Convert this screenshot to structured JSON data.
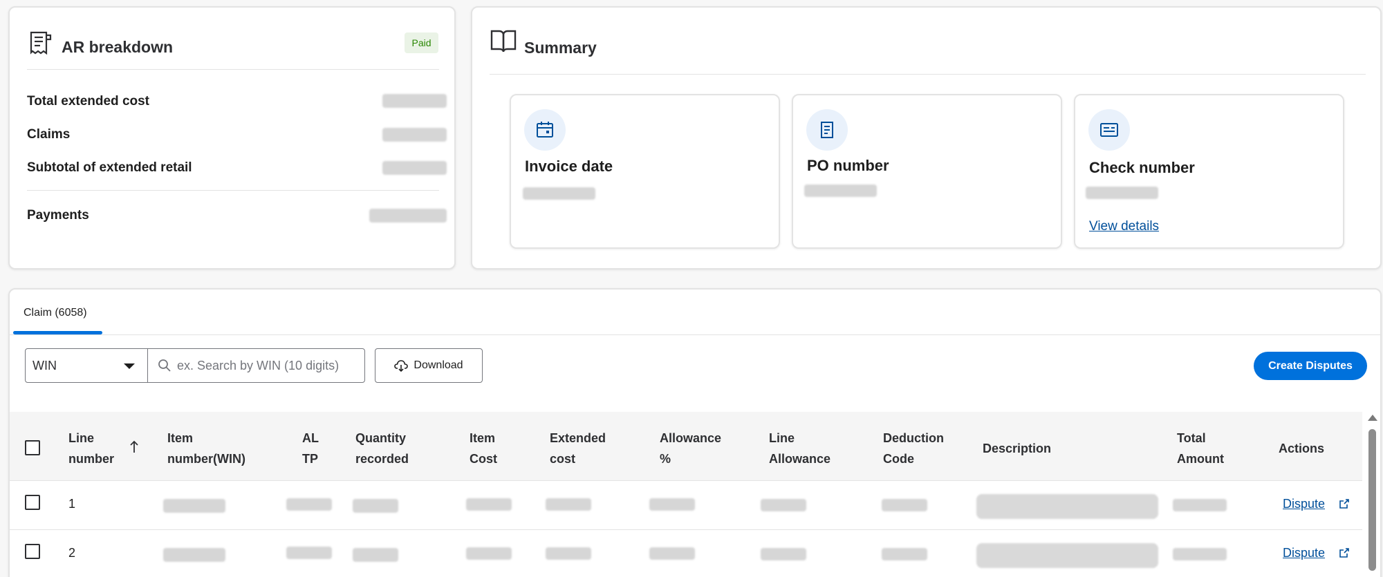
{
  "ar": {
    "title": "AR breakdown",
    "status": "Paid",
    "rows": [
      {
        "label": "Total extended cost"
      },
      {
        "label": "Claims"
      },
      {
        "label": "Subtotal of extended retail"
      },
      {
        "label": "Payments"
      }
    ]
  },
  "summary": {
    "title": "Summary",
    "tiles": [
      {
        "label": "Invoice date",
        "icon": "calendar-icon"
      },
      {
        "label": "PO number",
        "icon": "document-icon"
      },
      {
        "label": "Check number",
        "icon": "check-icon",
        "link": "View details"
      }
    ]
  },
  "claims": {
    "tab_label": "Claim (6058)",
    "filter": {
      "selected": "WIN"
    },
    "search": {
      "placeholder": "ex. Search by WIN (10 digits)"
    },
    "download_label": "Download",
    "create_label": "Create Disputes",
    "columns": [
      {
        "line1": "Line",
        "line2": "number"
      },
      {
        "line1": "Item",
        "line2": "number(WIN)"
      },
      {
        "line1": "AL",
        "line2": "TP"
      },
      {
        "line1": "Quantity",
        "line2": "recorded"
      },
      {
        "line1": "Item",
        "line2": "Cost"
      },
      {
        "line1": "Extended",
        "line2": "cost"
      },
      {
        "line1": "Allowance",
        "line2": "%"
      },
      {
        "line1": "Line",
        "line2": "Allowance"
      },
      {
        "line1": "Deduction",
        "line2": "Code"
      },
      {
        "line1": "Description",
        "line2": ""
      },
      {
        "line1": "Total",
        "line2": "Amount"
      },
      {
        "line1": "Actions",
        "line2": ""
      }
    ],
    "rows": [
      {
        "line_number": "1",
        "action": "Dispute"
      },
      {
        "line_number": "2",
        "action": "Dispute"
      }
    ]
  },
  "colors": {
    "accent": "#0071dc",
    "link": "#004f9a",
    "badge_bg": "#eaf3e6",
    "badge_text": "#2a8703"
  }
}
